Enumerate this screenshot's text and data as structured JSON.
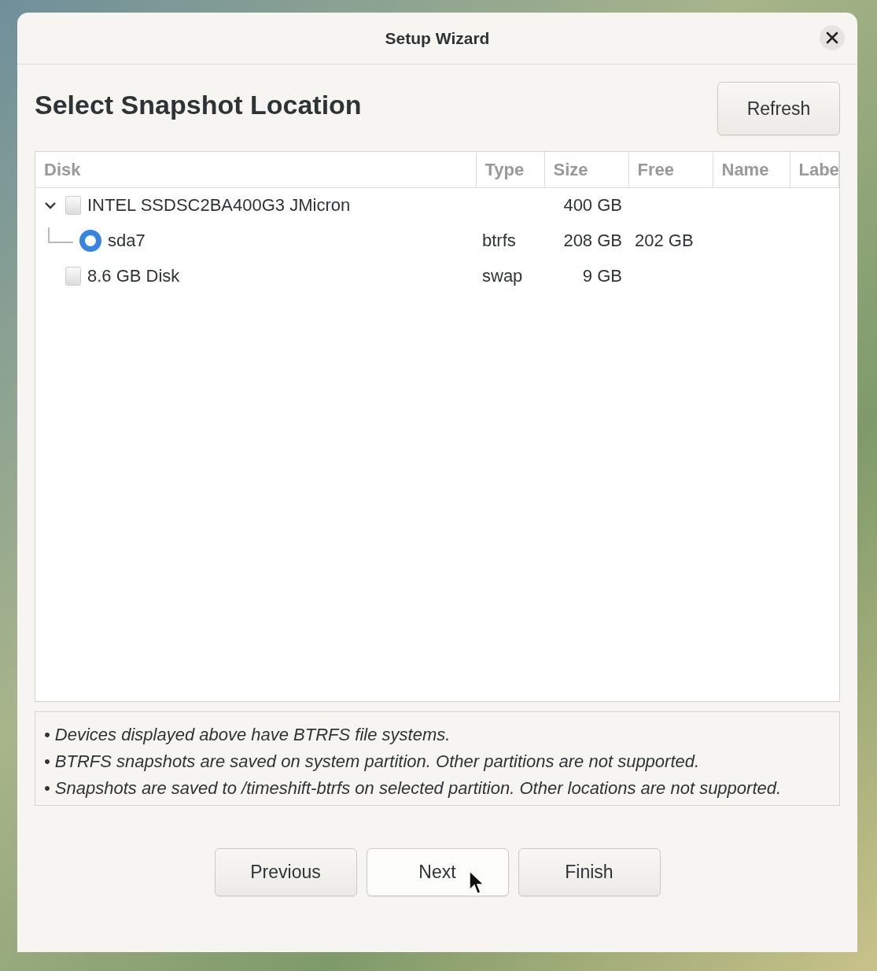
{
  "window": {
    "title": "Setup Wizard"
  },
  "heading": "Select Snapshot Location",
  "refresh_button": "Refresh",
  "table": {
    "columns": [
      "Disk",
      "Type",
      "Size",
      "Free",
      "Name",
      "Labe"
    ],
    "rows": [
      {
        "kind": "disk",
        "disk": "INTEL SSDSC2BA400G3 JMicron",
        "type": "",
        "size": "400 GB",
        "free": "",
        "expanded": true,
        "children": [
          {
            "kind": "partition",
            "disk": "sda7",
            "type": "btrfs",
            "size": "208 GB",
            "free": "202 GB",
            "selected": true
          }
        ]
      },
      {
        "kind": "disk",
        "disk": "8.6 GB Disk",
        "type": "swap",
        "size": "9 GB",
        "free": ""
      }
    ]
  },
  "notes": [
    "• Devices displayed above have BTRFS file systems.",
    "• BTRFS snapshots are saved on system partition. Other partitions are not supported.",
    "• Snapshots are saved to /timeshift-btrfs on selected partition. Other locations are not supported."
  ],
  "buttons": [
    {
      "label": "Previous",
      "hovered": false
    },
    {
      "label": "Next",
      "hovered": true
    },
    {
      "label": "Finish",
      "hovered": false
    }
  ]
}
